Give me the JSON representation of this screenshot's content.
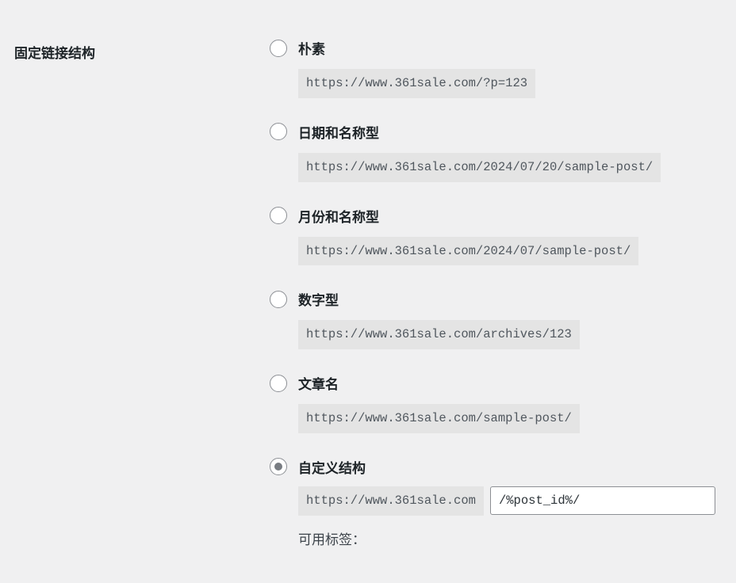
{
  "section_label": "固定链接结构",
  "options": {
    "plain": {
      "label": "朴素",
      "url": "https://www.361sale.com/?p=123",
      "checked": false
    },
    "day_name": {
      "label": "日期和名称型",
      "url": "https://www.361sale.com/2024/07/20/sample-post/",
      "checked": false
    },
    "month_name": {
      "label": "月份和名称型",
      "url": "https://www.361sale.com/2024/07/sample-post/",
      "checked": false
    },
    "numeric": {
      "label": "数字型",
      "url": "https://www.361sale.com/archives/123",
      "checked": false
    },
    "post_name": {
      "label": "文章名",
      "url": "https://www.361sale.com/sample-post/",
      "checked": false
    },
    "custom": {
      "label": "自定义结构",
      "base_url": "https://www.361sale.com",
      "value": "/%post_id%/",
      "checked": true
    }
  },
  "available_tags_label": "可用标签："
}
